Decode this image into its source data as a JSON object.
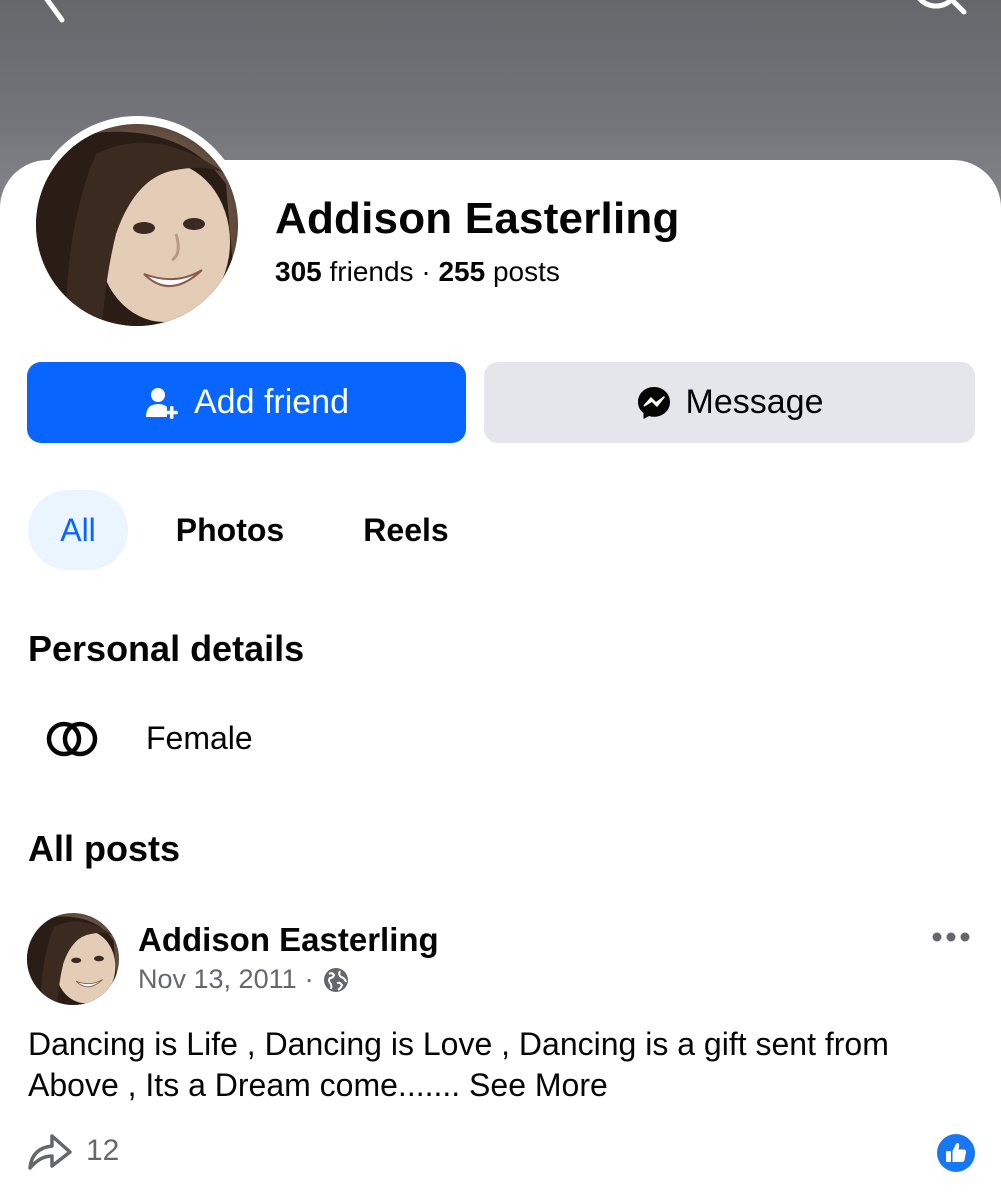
{
  "header": {
    "back_icon": "chevron-left-icon",
    "search_icon": "search-icon"
  },
  "profile": {
    "name": "Addison Easterling",
    "friends_count": "305",
    "friends_label": "friends",
    "separator": "·",
    "posts_count": "255",
    "posts_label": "posts"
  },
  "actions": {
    "add_friend_label": "Add friend",
    "message_label": "Message"
  },
  "tabs": [
    {
      "label": "All",
      "active": true
    },
    {
      "label": "Photos",
      "active": false
    },
    {
      "label": "Reels",
      "active": false
    }
  ],
  "personal_details": {
    "title": "Personal details",
    "items": [
      {
        "icon": "gender-rings-icon",
        "text": "Female"
      }
    ]
  },
  "posts_section": {
    "title": "All posts"
  },
  "post": {
    "author": "Addison Easterling",
    "date": "Nov 13, 2011",
    "meta_separator": "·",
    "privacy_icon": "globe-icon",
    "text": "Dancing is Life , Dancing is Love , Dancing is a gift sent from Above , Its a Dream come.......",
    "see_more": "See More",
    "shares": "12"
  },
  "colors": {
    "primary": "#0866ff",
    "secondary_button": "#e4e6eb",
    "active_tab_bg": "#ebf5ff",
    "muted_text": "#65676b",
    "like_badge": "#1877f2"
  }
}
